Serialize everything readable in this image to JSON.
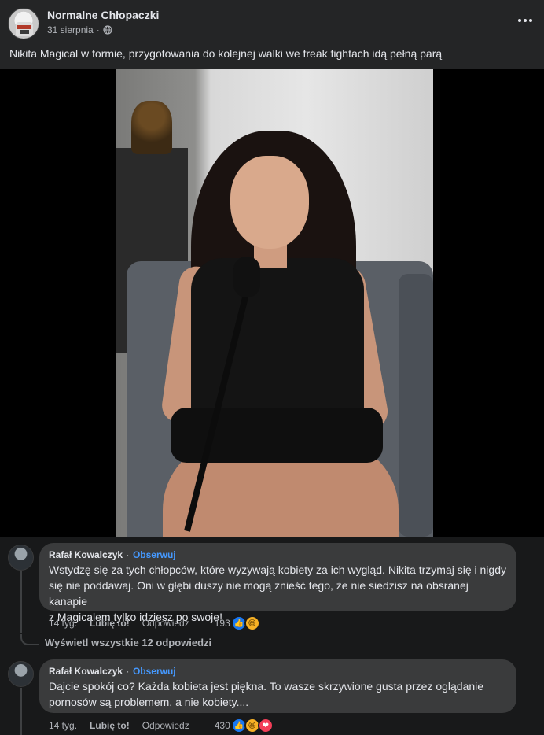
{
  "post": {
    "page_name": "Normalne Chłopaczki",
    "date": "31 sierpnia",
    "separator": "·",
    "privacy_icon": "globe-icon",
    "text": "Nikita Magical w formie, przygotowania do kolejnej walki we freak fightach idą pełną parą"
  },
  "comments": [
    {
      "author": "Rafał Kowalczyk",
      "separator": "·",
      "follow": "Obserwuj",
      "text_lines": [
        "Wstydzę się za tych chłopców, które wyzywają kobiety za ich wygląd. Nikita trzymaj się i nigdy",
        "się nie poddawaj. Oni w głębi duszy nie mogą znieść tego, że nie siedzisz na obsranej kanapie",
        "z Magicalem tylko idziesz po swoje!"
      ],
      "time": "14 tyg.",
      "like": "Lubię to!",
      "reply": "Odpowiedz",
      "reaction_count": "193",
      "reactions": [
        "like-icon",
        "haha-icon"
      ]
    },
    {
      "author": "Rafał Kowalczyk",
      "separator": "·",
      "follow": "Obserwuj",
      "text_lines": [
        "Dajcie spokój co? Każda kobieta jest piękna. To wasze skrzywione gusta przez oglądanie",
        "pornosów są problemem, a nie kobiety...."
      ],
      "time": "14 tyg.",
      "like": "Lubię to!",
      "reply": "Odpowiedz",
      "reaction_count": "430",
      "reactions": [
        "like-icon",
        "haha-icon",
        "love-icon"
      ]
    }
  ],
  "view_replies": "Wyświetl wszystkie 12 odpowiedzi",
  "colors": {
    "background": "#18191a",
    "card": "#242526",
    "bubble": "#3a3b3c",
    "accent": "#4599ff",
    "like": "#1877f2"
  }
}
